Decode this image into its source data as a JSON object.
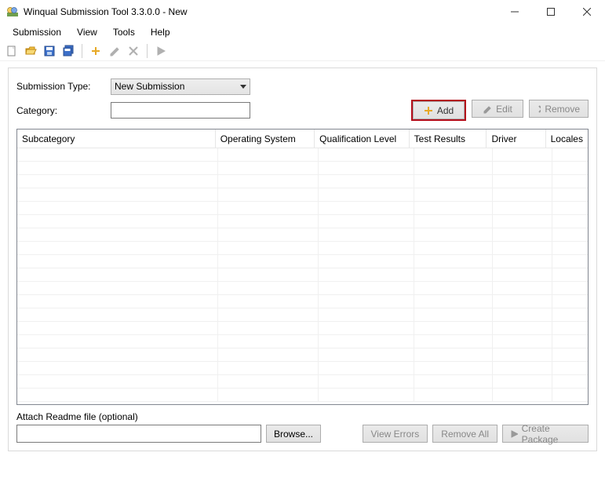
{
  "window": {
    "title": "Winqual Submission Tool 3.3.0.0 - New"
  },
  "menu": {
    "submission": "Submission",
    "view": "View",
    "tools": "Tools",
    "help": "Help"
  },
  "form": {
    "submission_type_label": "Submission Type:",
    "submission_type_value": "New Submission",
    "category_label": "Category:",
    "category_value": ""
  },
  "buttons": {
    "add": "Add",
    "edit": "Edit",
    "remove": "Remove",
    "browse": "Browse...",
    "view_errors": "View Errors",
    "remove_all": "Remove All",
    "create_package": "Create Package"
  },
  "table": {
    "headers": {
      "subcategory": "Subcategory",
      "os": "Operating System",
      "qual": "Qualification Level",
      "test": "Test Results",
      "driver": "Driver",
      "locales": "Locales"
    }
  },
  "attach": {
    "label": "Attach Readme file (optional)",
    "value": ""
  }
}
